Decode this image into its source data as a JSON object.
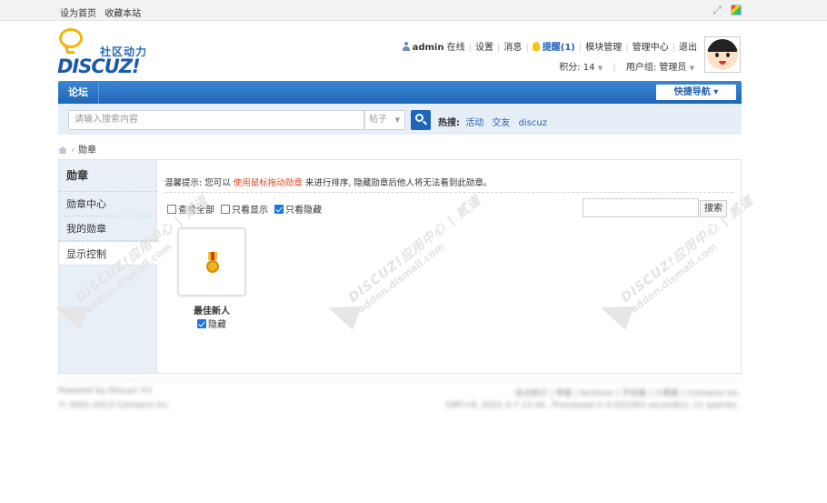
{
  "topbar": {
    "set_home": "设为首页",
    "bookmark": "收藏本站",
    "expand_icon": "expand-icon",
    "theme_icon": "theme-icon"
  },
  "logo": {
    "slogan": "社区动力",
    "brand": "DISCUZ!"
  },
  "user": {
    "name": "admin",
    "online": "在线",
    "settings": "设置",
    "messages": "消息",
    "remind": "提醒(1)",
    "modules": "模块管理",
    "admin_center": "管理中心",
    "logout": "退出",
    "credits": "积分: 14",
    "usergroup": "用户组: 管理员"
  },
  "nav": {
    "forum": "论坛",
    "quicknav": "快捷导航"
  },
  "search": {
    "placeholder": "请输入搜索内容",
    "type": "帖子",
    "hot_label": "热搜:",
    "hot_tags": [
      "活动",
      "交友",
      "discuz"
    ]
  },
  "breadcrumb": {
    "current": "勋章"
  },
  "sidebar": {
    "title": "勋章",
    "items": [
      {
        "label": "勋章中心"
      },
      {
        "label": "我的勋章"
      },
      {
        "label": "显示控制"
      }
    ]
  },
  "main": {
    "tip_prefix": "温馨提示: 您可以",
    "tip_highlight": "使用鼠标拖动勋章",
    "tip_suffix": "来进行排序, 隐藏勋章后他人将无法看到此勋章。",
    "filters": [
      {
        "label": "查看全部",
        "checked": false
      },
      {
        "label": "只看显示",
        "checked": false
      },
      {
        "label": "只看隐藏",
        "checked": true
      }
    ],
    "search_button": "搜索",
    "medal": {
      "name": "最佳新人",
      "hide_label": "隐藏",
      "hidden": true
    }
  },
  "watermark": {
    "brand": "DISCUZ!应用中心 | 贰道",
    "site": "addon.dismall.com"
  },
  "footer": {
    "powered": "Powered by Discuz! X3",
    "copyright": "© 2001-2013 Comsenz Inc.",
    "links": "站点统计 | 举报 | Archiver | 手机版 | 小黑屋 | Comsenz Inc.",
    "stats": "GMT+8, 2021-3-7 13:34 , Processed in 0.021563 second(s), 11 queries ."
  },
  "colors": {
    "nav_blue": "#1f66b8",
    "link_blue": "#2a62b5",
    "highlight_orange": "#e0461f"
  }
}
